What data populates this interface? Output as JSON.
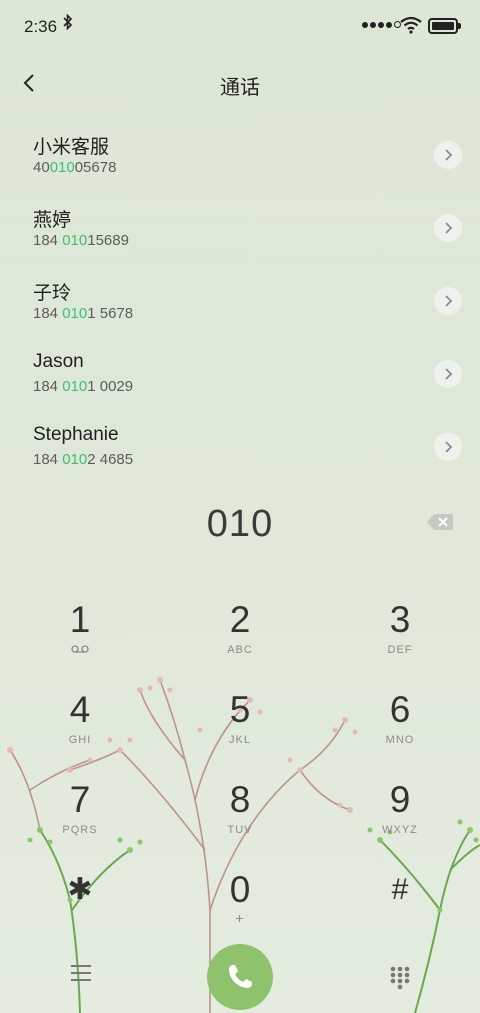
{
  "status": {
    "time": "2:36"
  },
  "header": {
    "title": "通话"
  },
  "contacts": [
    {
      "name": "小米客服",
      "num_pre": "40",
      "num_match": "010",
      "num_post": "05678"
    },
    {
      "name": "燕婷",
      "num_pre": "184 ",
      "num_match": "010",
      "num_post": "15689"
    },
    {
      "name": "子玲",
      "num_pre": "184 ",
      "num_match": "010",
      "num_post": "1 5678"
    },
    {
      "name": "Jason",
      "num_pre": "184 ",
      "num_match": "010",
      "num_post": "1 0029"
    },
    {
      "name": "Stephanie",
      "num_pre": "184 ",
      "num_match": "010",
      "num_post": "2 4685"
    }
  ],
  "dialed": "010",
  "keypad": [
    {
      "digit": "1",
      "letters": ""
    },
    {
      "digit": "2",
      "letters": "ABC"
    },
    {
      "digit": "3",
      "letters": "DEF"
    },
    {
      "digit": "4",
      "letters": "GHI"
    },
    {
      "digit": "5",
      "letters": "JKL"
    },
    {
      "digit": "6",
      "letters": "MNO"
    },
    {
      "digit": "7",
      "letters": "PQRS"
    },
    {
      "digit": "8",
      "letters": "TUV"
    },
    {
      "digit": "9",
      "letters": "WXYZ"
    },
    {
      "digit": "✱",
      "letters": ""
    },
    {
      "digit": "0",
      "letters": "+"
    },
    {
      "digit": "#",
      "letters": ""
    }
  ],
  "icons": {
    "bluetooth": "bluetooth-icon",
    "voicemail": "voicemail-icon",
    "call": "phone-icon"
  },
  "colors": {
    "match": "#3fbf6f",
    "call_button": "#8fc26d"
  }
}
